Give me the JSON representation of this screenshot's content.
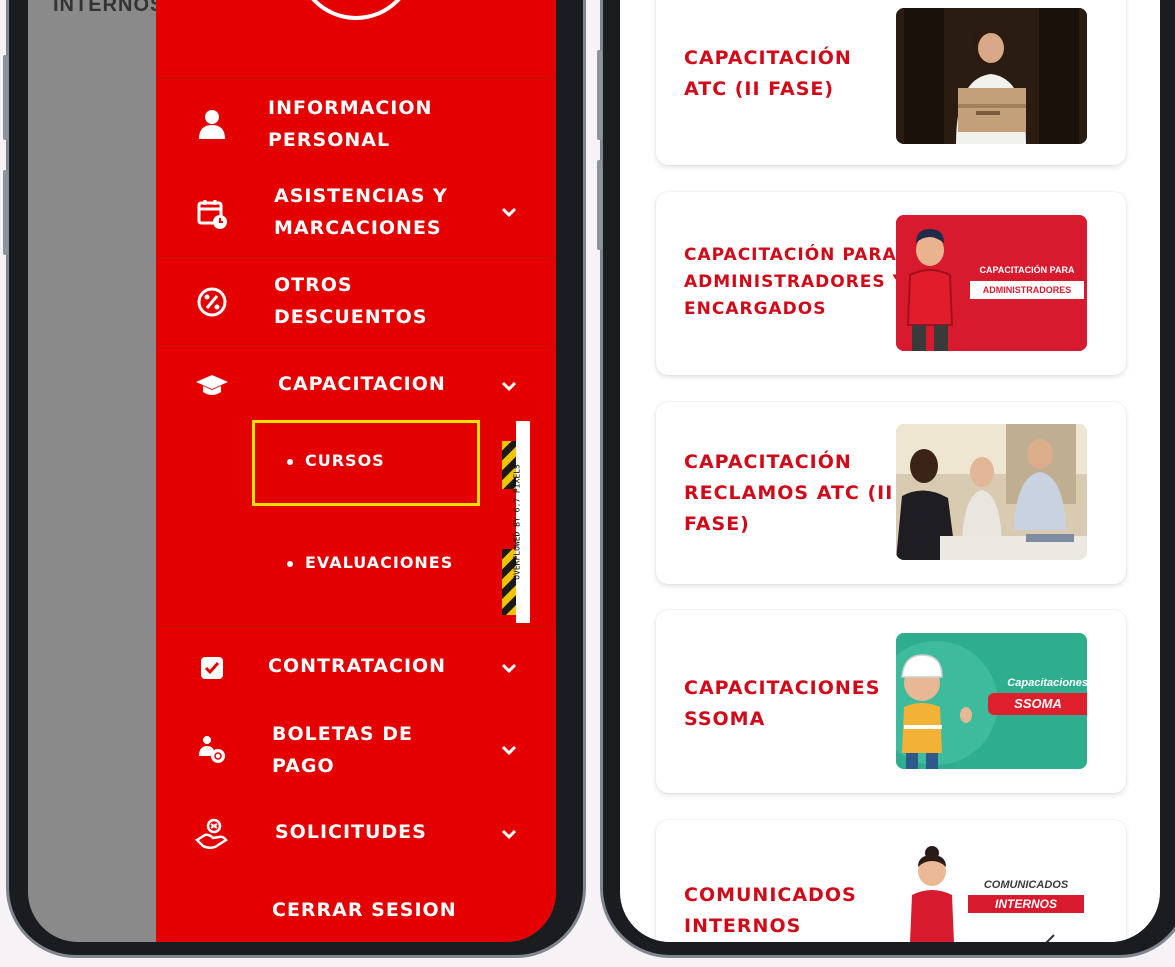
{
  "left_app": {
    "background_peek_text": "INTERNOS",
    "menu": [
      {
        "label_line1": "INFORMACION",
        "label_line2": "PERSONAL",
        "icon": "user-icon",
        "has_chevron": false
      },
      {
        "label_line1": "ASISTENCIAS Y",
        "label_line2": "MARCACIONES",
        "icon": "calendar-clock-icon",
        "has_chevron": true
      },
      {
        "label_line1": "OTROS",
        "label_line2": "DESCUENTOS",
        "icon": "percent-icon",
        "has_chevron": false
      },
      {
        "label_line1": "CAPACITACION",
        "icon": "graduation-cap-icon",
        "has_chevron": true,
        "expanded": true
      },
      {
        "label_line1": "CONTRATACION",
        "icon": "checkbox-icon",
        "has_chevron": true
      },
      {
        "label_line1": "BOLETAS DE",
        "label_line2": "PAGO",
        "icon": "payroll-person-icon",
        "has_chevron": true
      },
      {
        "label_line1": "SOLICITUDES",
        "icon": "hand-request-icon",
        "has_chevron": true
      },
      {
        "label_line1": "CERRAR SESION",
        "has_chevron": false
      }
    ],
    "submenu": [
      {
        "label": "CURSOS",
        "selected": true
      },
      {
        "label": "EVALUACIONES",
        "selected": false
      }
    ],
    "overflow_warning": "OVERFLOWED BY 6.7 PIXELS"
  },
  "right_app": {
    "cards": [
      {
        "title_lines": [
          "CAPACITACIÓN",
          "ATC (II FASE)"
        ],
        "image": "woman-holding-package"
      },
      {
        "title_lines": [
          "CAPACITACIÓN PARA",
          "ADMINISTRADORES Y",
          "ENCARGADOS"
        ],
        "image": "mascot-administradores",
        "img_text_top": "CAPACITACIÓN PARA",
        "img_text_badge": "ADMINISTRADORES"
      },
      {
        "title_lines": [
          "CAPACITACIÓN",
          "RECLAMOS ATC (II",
          "FASE)"
        ],
        "image": "office-meeting-photo"
      },
      {
        "title_lines": [
          "CAPACITACIONES",
          "SSOMA"
        ],
        "image": "mascot-ssoma",
        "img_text_top": "Capacitaciones",
        "img_text_badge": "SSOMA"
      },
      {
        "title_lines": [
          "COMUNICADOS",
          "INTERNOS"
        ],
        "image": "mascot-comunicados",
        "img_text_top": "COMUNICADOS",
        "img_text_badge": "INTERNOS"
      }
    ]
  },
  "colors": {
    "drawer_red": "#e50000",
    "title_red": "#d10a1a",
    "highlight_yellow": "#f1e000",
    "ssoma_green": "#2fae8f"
  }
}
